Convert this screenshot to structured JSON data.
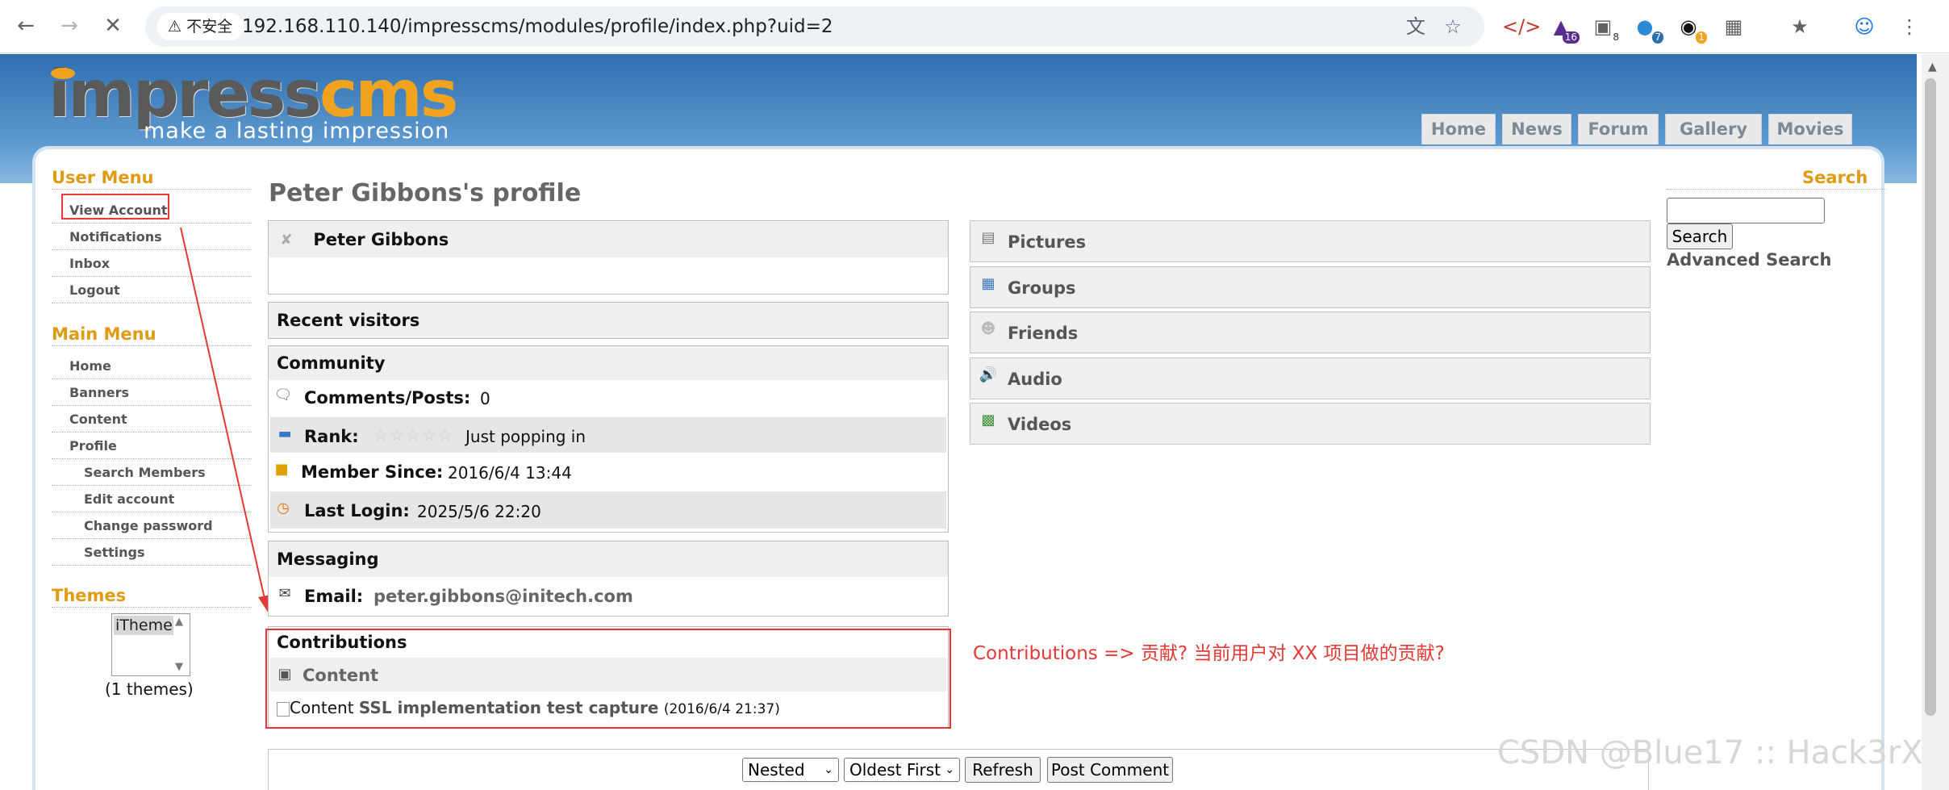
{
  "browser": {
    "security_label": "不安全",
    "url": "192.168.110.140/impresscms/modules/profile/index.php?uid=2",
    "ext_badges": [
      "16",
      "8",
      "7",
      "1"
    ]
  },
  "site": {
    "logo_text_a": "impress",
    "logo_text_b": "cms",
    "tagline": "make a lasting impression",
    "nav": [
      "Home",
      "News",
      "Forum",
      "Gallery",
      "Movies"
    ],
    "colors": {
      "accent": "#e09b16",
      "banner": "#3b7dbf",
      "annotation": "#e53935"
    }
  },
  "user_menu": {
    "title": "User Menu",
    "items": [
      "View Account",
      "Notifications",
      "Inbox",
      "Logout"
    ]
  },
  "main_menu": {
    "title": "Main Menu",
    "items": [
      "Home",
      "Banners",
      "Content",
      "Profile"
    ],
    "subitems": [
      "Search Members",
      "Edit account",
      "Change password",
      "Settings"
    ]
  },
  "themes": {
    "title": "Themes",
    "selected": "iTheme",
    "count": "(1 themes)"
  },
  "profile": {
    "title": "Peter Gibbons's profile",
    "name": "Peter Gibbons",
    "recent_visitors": "Recent visitors",
    "community": {
      "title": "Community",
      "comments_label": "Comments/Posts:",
      "comments_value": "0",
      "rank_label": "Rank:",
      "rank_value": "Just popping in",
      "rank_stars": 0,
      "member_since_label": "Member Since:",
      "member_since_value": "2016/6/4 13:44",
      "last_login_label": "Last Login:",
      "last_login_value": "2025/5/6 22:20"
    },
    "messaging": {
      "title": "Messaging",
      "email_label": "Email:",
      "email_value": "peter.gibbons@initech.com"
    },
    "contributions": {
      "title": "Contributions",
      "section": "Content",
      "item_prefix": "Content",
      "item_title": "SSL implementation test capture",
      "item_date": "(2016/6/4 21:37)"
    }
  },
  "right_sections": [
    "Pictures",
    "Groups",
    "Friends",
    "Audio",
    "Videos"
  ],
  "search": {
    "title": "Search",
    "button": "Search",
    "advanced": "Advanced Search"
  },
  "comments_bar": {
    "mode": "Nested",
    "order": "Oldest First",
    "refresh": "Refresh",
    "post": "Post Comment"
  },
  "annotation": "Contributions => 贡献? 当前用户对 XX 项目做的贡献?",
  "watermark": "CSDN @Blue17 :: Hack3rX"
}
